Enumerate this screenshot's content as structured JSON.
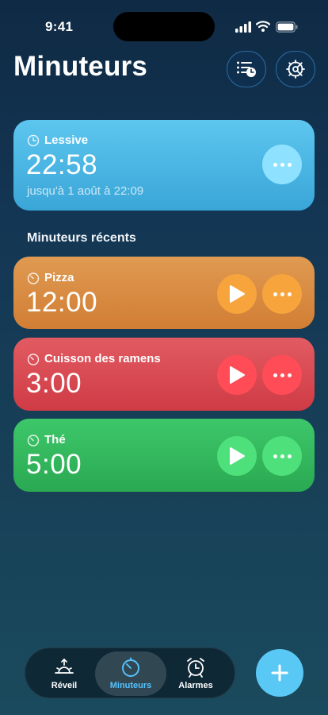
{
  "status_bar": {
    "time": "9:41"
  },
  "header": {
    "title": "Minuteurs",
    "list_button_icon": "list-clock-icon",
    "settings_button_icon": "gear-icon"
  },
  "active_timer": {
    "label": "Lessive",
    "time": "22:58",
    "until": "jusqu'à 1 août à 22:09",
    "color": "#4ab7e4"
  },
  "recent_section": {
    "title": "Minuteurs récents"
  },
  "recent_timers": [
    {
      "label": "Pizza",
      "time": "12:00",
      "color": "#d98a40"
    },
    {
      "label": "Cuisson des ramens",
      "time": "3:00",
      "color": "#d9464e"
    },
    {
      "label": "Thé",
      "time": "5:00",
      "color": "#34b85c"
    }
  ],
  "tab_bar": {
    "tabs": [
      {
        "label": "Réveil",
        "icon": "sunrise-icon"
      },
      {
        "label": "Minuteurs",
        "icon": "timer-icon",
        "selected": true
      },
      {
        "label": "Alarmes",
        "icon": "alarm-clock-icon"
      }
    ],
    "accent": "#56c3ff"
  },
  "add_button": {
    "icon": "plus-icon",
    "color": "#5ac8f5"
  }
}
